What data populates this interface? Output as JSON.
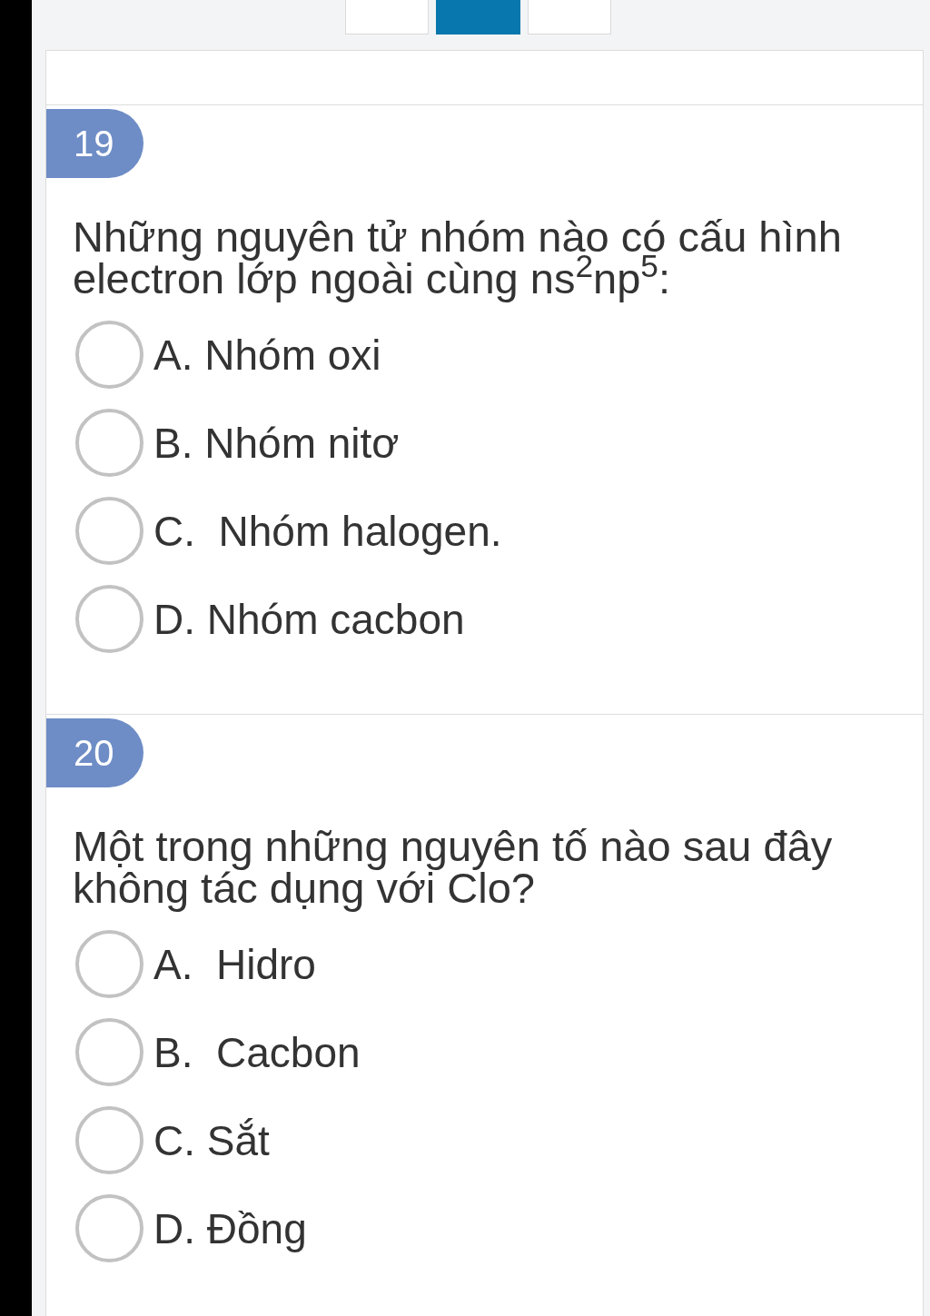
{
  "pagination": [
    {
      "selected": false
    },
    {
      "selected": true
    },
    {
      "selected": false
    }
  ],
  "questions": [
    {
      "number": "19",
      "text": "Những nguyên tử nhóm nào có cấu hình electron lớp ngoài cùng ns$^{2}$np$^{5}$:",
      "options": [
        {
          "label": "A. Nhóm oxi",
          "selected": false
        },
        {
          "label": "B. Nhóm nitơ",
          "selected": false
        },
        {
          "label": "C.  Nhóm halogen.",
          "selected": false
        },
        {
          "label": "D. Nhóm cacbon",
          "selected": false
        }
      ]
    },
    {
      "number": "20",
      "text": "Một trong những nguyên tố nào sau đây không tác dụng với Clo?",
      "options": [
        {
          "label": "A.  Hidro",
          "selected": false
        },
        {
          "label": "B.  Cacbon",
          "selected": false
        },
        {
          "label": "C. Sắt",
          "selected": false
        },
        {
          "label": "D. Đồng",
          "selected": false
        }
      ]
    }
  ]
}
